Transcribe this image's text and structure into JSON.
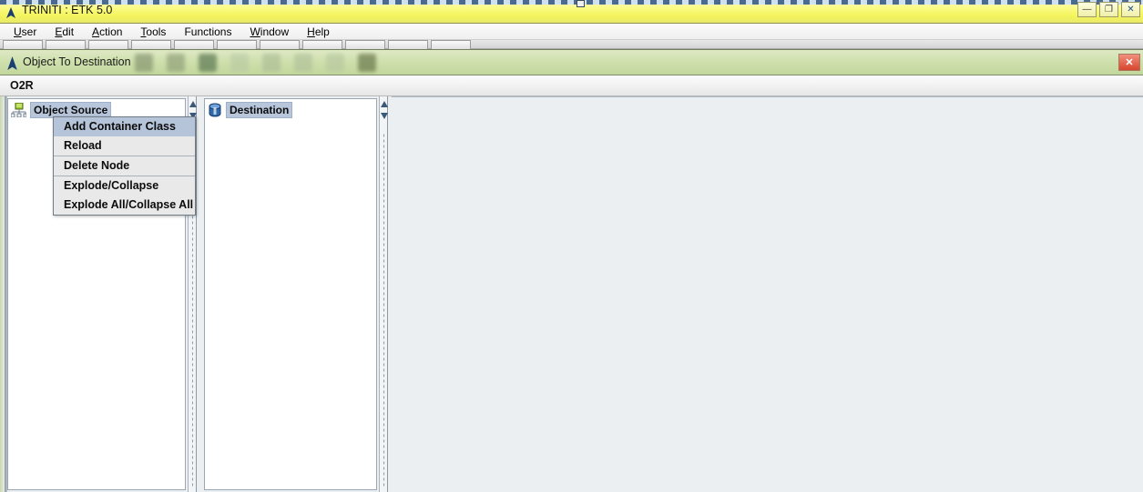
{
  "window": {
    "title": "TRINITI : ETK 5.0",
    "title_icon": "app-triangle-icon",
    "buttons": {
      "minimize": "—",
      "restore": "❐",
      "close": "✕"
    }
  },
  "menubar": {
    "items": [
      {
        "label": "User",
        "mnemonic": "U"
      },
      {
        "label": "Edit",
        "mnemonic": "E"
      },
      {
        "label": "Action",
        "mnemonic": "A"
      },
      {
        "label": "Tools",
        "mnemonic": "T"
      },
      {
        "label": "Functions",
        "mnemonic": ""
      },
      {
        "label": "Window",
        "mnemonic": "W"
      },
      {
        "label": "Help",
        "mnemonic": "H"
      }
    ]
  },
  "toolbar": {
    "icon": "app-triangle-icon",
    "title": "Object To Destination",
    "close_label": "✕",
    "tool_icons": [
      "toolbar-icon-1",
      "toolbar-icon-2",
      "toolbar-icon-3",
      "toolbar-icon-4",
      "toolbar-icon-5",
      "toolbar-icon-6",
      "toolbar-icon-7",
      "toolbar-icon-8"
    ]
  },
  "tab": {
    "label": "O2R"
  },
  "panels": {
    "source": {
      "node_label": "Object Source",
      "node_icon": "hierarchy-node-icon"
    },
    "destination": {
      "node_label": "Destination",
      "node_icon": "database-cylinder-icon"
    }
  },
  "context_menu": {
    "items": [
      {
        "label": "Add Container Class",
        "selected": true,
        "separator_after": false
      },
      {
        "label": "Reload",
        "selected": false,
        "separator_after": true
      },
      {
        "label": "Delete Node",
        "selected": false,
        "separator_after": true
      },
      {
        "label": "Explode/Collapse",
        "selected": false,
        "separator_after": false
      },
      {
        "label": "Explode All/Collapse All",
        "selected": false,
        "separator_after": false
      }
    ]
  },
  "colors": {
    "titlebar_yellow": "#f4f45c",
    "toolbar_green": "#cfe0ad",
    "selection_blue": "#b8c6dc",
    "menu_highlight": "#b6c4da",
    "close_red": "#d8452c"
  }
}
